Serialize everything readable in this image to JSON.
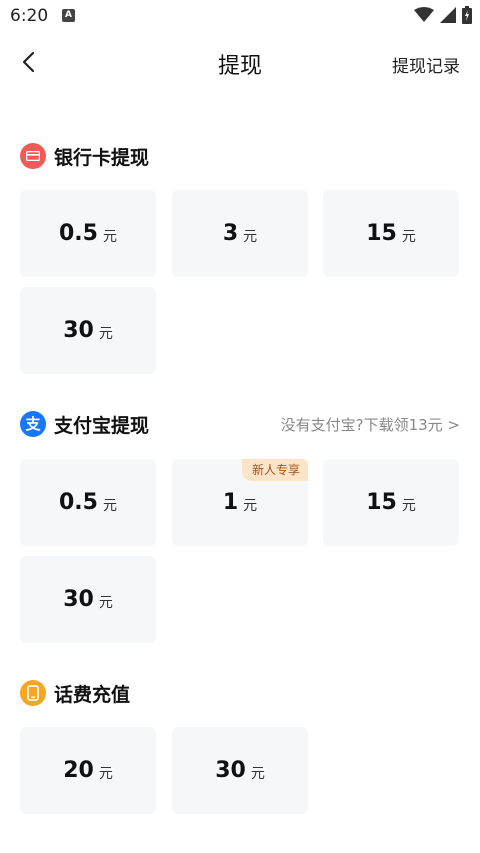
{
  "status_bar": {
    "time": "6:20",
    "notif_icon": "A"
  },
  "nav": {
    "title": "提现",
    "action": "提现记录"
  },
  "sections": [
    {
      "title": "银行卡提现",
      "icon": "card-icon",
      "color": "#f25a5a",
      "items": [
        {
          "amount": "0.5",
          "unit": "元"
        },
        {
          "amount": "3",
          "unit": "元"
        },
        {
          "amount": "15",
          "unit": "元"
        },
        {
          "amount": "30",
          "unit": "元"
        }
      ]
    },
    {
      "title": "支付宝提现",
      "icon": "alipay-icon",
      "color": "#1677ff",
      "link": "没有支付宝?下载领13元 >",
      "items": [
        {
          "amount": "0.5",
          "unit": "元"
        },
        {
          "amount": "1",
          "unit": "元",
          "badge": "新人专享"
        },
        {
          "amount": "15",
          "unit": "元"
        },
        {
          "amount": "30",
          "unit": "元"
        }
      ]
    },
    {
      "title": "话费充值",
      "icon": "phone-icon",
      "color": "#f5a623",
      "items": [
        {
          "amount": "20",
          "unit": "元"
        },
        {
          "amount": "30",
          "unit": "元"
        }
      ]
    }
  ]
}
